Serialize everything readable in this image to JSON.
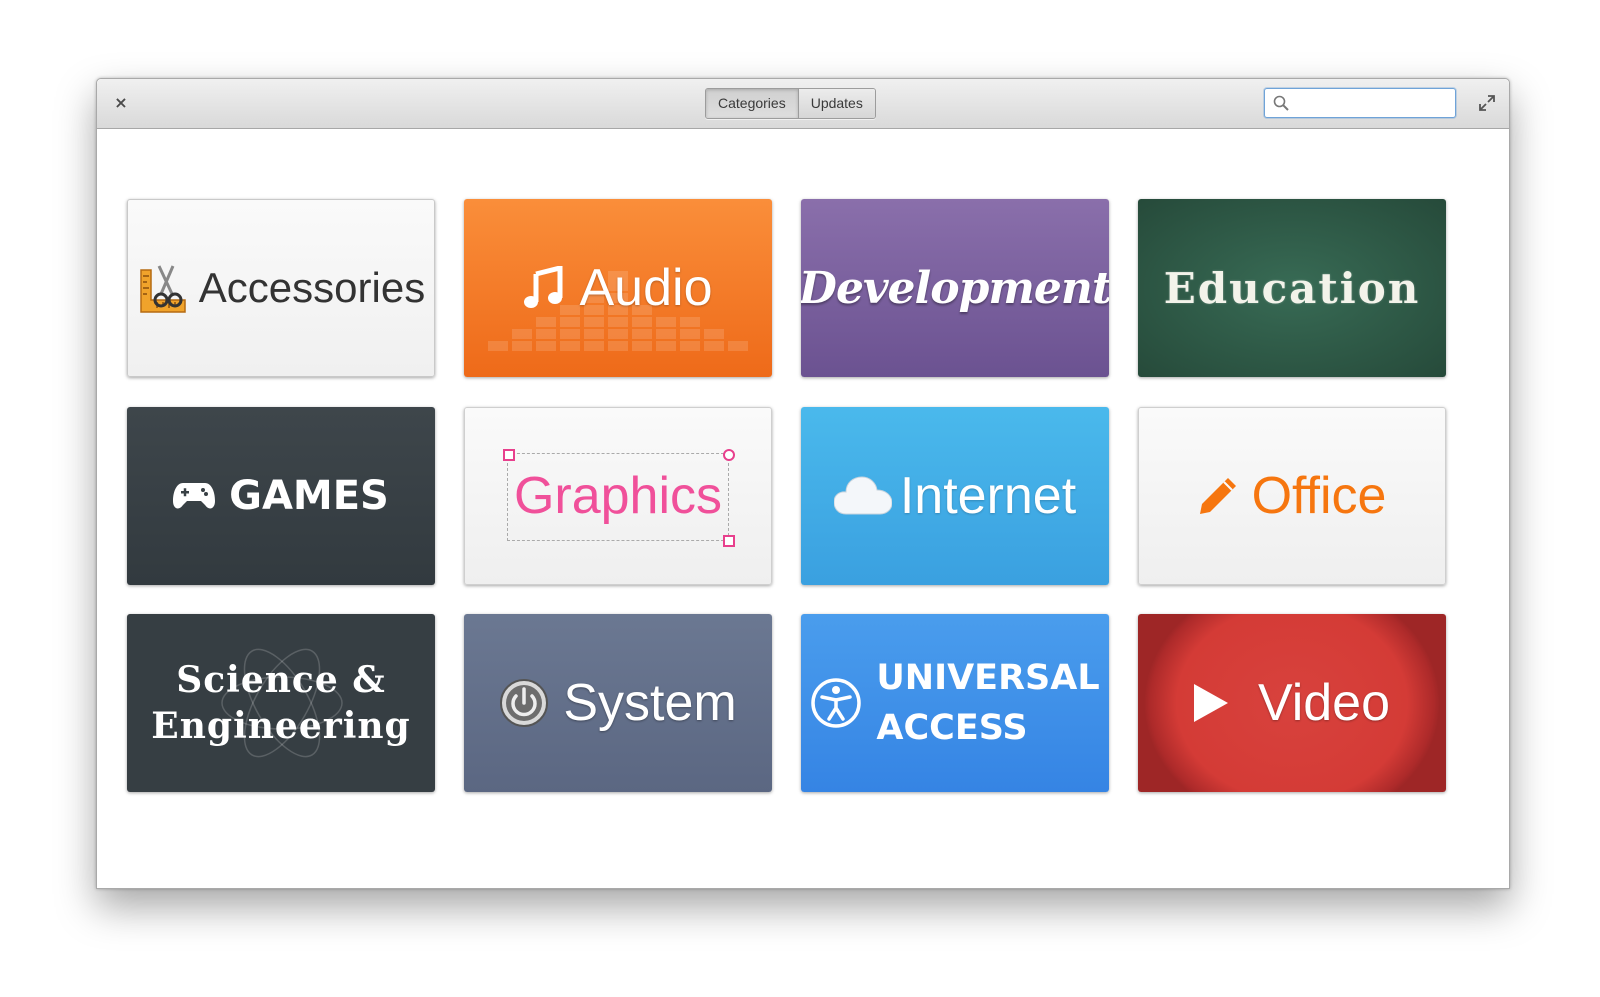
{
  "window": {
    "close_icon": "×",
    "mode_buttons": [
      "Categories",
      "Updates"
    ],
    "active_mode": "Categories",
    "search_placeholder": "",
    "maximize_icon": "maximize-icon"
  },
  "categories": [
    {
      "label": "Accessories",
      "icon": "scissors-ruler-icon",
      "color": "#f4f4f4"
    },
    {
      "label": "Audio",
      "icon": "music-note-icon",
      "color": "#f47b26"
    },
    {
      "label": "Development",
      "icon": "",
      "color": "#7a609e"
    },
    {
      "label": "Education",
      "icon": "",
      "color": "#2f5c48"
    },
    {
      "label": "GAMES",
      "icon": "gamepad-icon",
      "color": "#384045"
    },
    {
      "label": "Graphics",
      "icon": "selection-handles-icon",
      "color": "#f4f4f4"
    },
    {
      "label": "Internet",
      "icon": "cloud-icon",
      "color": "#42ace6"
    },
    {
      "label": "Office",
      "icon": "pencil-icon",
      "color": "#f4f4f4"
    },
    {
      "label": "Science &",
      "label2": "Engineering",
      "icon": "atom-icon",
      "color": "#363e43"
    },
    {
      "label": "System",
      "icon": "power-icon",
      "color": "#63708a"
    },
    {
      "label": "UNIVERSAL",
      "label2": "ACCESS",
      "icon": "accessibility-icon",
      "color": "#3d8fe8"
    },
    {
      "label": "Video",
      "icon": "play-icon",
      "color": "#cf3836"
    }
  ]
}
